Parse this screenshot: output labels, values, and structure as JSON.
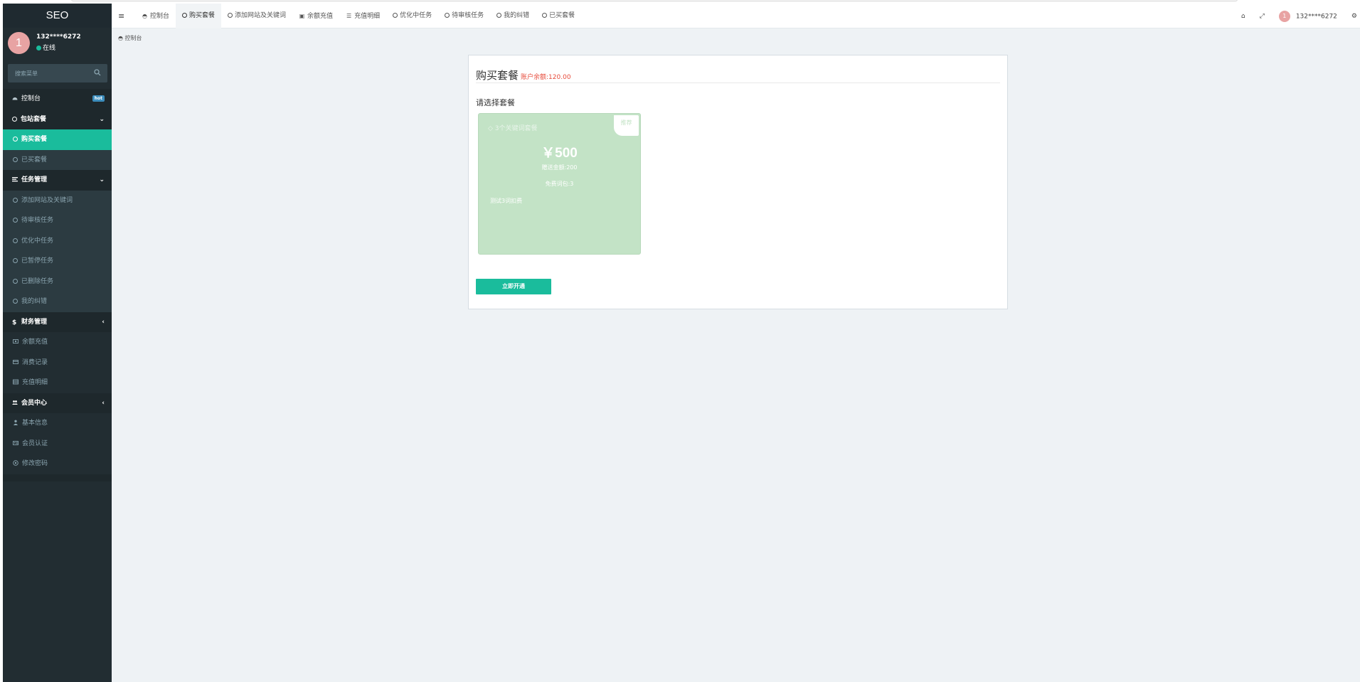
{
  "sidebar": {
    "logo": "SEO",
    "user": {
      "avatar_text": "1",
      "name": "132****6272",
      "status": "在线"
    },
    "search": {
      "placeholder": "搜索菜单"
    },
    "items": [
      {
        "label": "控制台",
        "badge": "hot"
      },
      {
        "label": "包站套餐"
      },
      {
        "label": "购买套餐"
      },
      {
        "label": "已买套餐"
      },
      {
        "label": "任务管理"
      },
      {
        "label": "添加网站及关键词"
      },
      {
        "label": "待审核任务"
      },
      {
        "label": "优化中任务"
      },
      {
        "label": "已暂停任务"
      },
      {
        "label": "已删除任务"
      },
      {
        "label": "我的纠错"
      },
      {
        "label": "财务管理"
      },
      {
        "label": "余额充值"
      },
      {
        "label": "消费记录"
      },
      {
        "label": "充值明细"
      },
      {
        "label": "会员中心"
      },
      {
        "label": "基本信息"
      },
      {
        "label": "会员认证"
      },
      {
        "label": "修改密码"
      }
    ]
  },
  "topnav": {
    "tabs": [
      {
        "label": "控制台"
      },
      {
        "label": "购买套餐"
      },
      {
        "label": "添加网站及关键词"
      },
      {
        "label": "余额充值"
      },
      {
        "label": "充值明细"
      },
      {
        "label": "优化中任务"
      },
      {
        "label": "待审核任务"
      },
      {
        "label": "我的纠错"
      },
      {
        "label": "已买套餐"
      }
    ],
    "user_avatar_text": "1",
    "user_name": "132****6272"
  },
  "breadcrumb": "控制台",
  "panel": {
    "title": "购买套餐",
    "balance": "账户余额:120.00",
    "choose_label": "请选择套餐",
    "card": {
      "corner": "推荐",
      "name": "3个关键词套餐",
      "price": "￥500",
      "gift": "赠送金额:200",
      "free": "免费词包:3",
      "desc": "测试3词扣费"
    },
    "button": "立即开通"
  },
  "colors": {
    "accent": "#1abc9c",
    "sidebar": "#222d32",
    "card": "#c3e3c6",
    "balance": "#e74c3c"
  }
}
